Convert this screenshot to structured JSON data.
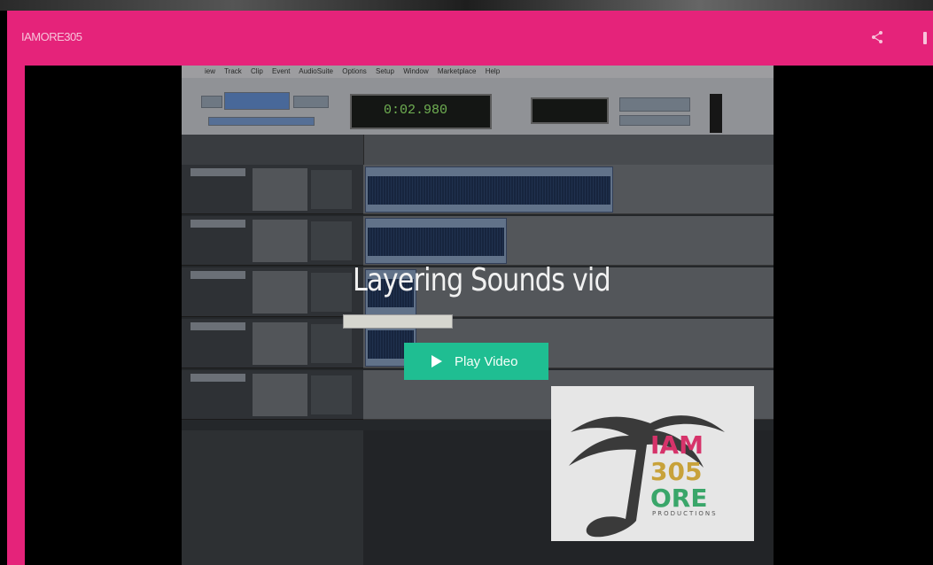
{
  "channel": {
    "name": "IAMORE305"
  },
  "video": {
    "title": "Layering Sounds vid",
    "play_label": "Play Video"
  },
  "daw": {
    "menu": [
      "iew",
      "Track",
      "Clip",
      "Event",
      "AudioSuite",
      "Options",
      "Setup",
      "Window",
      "Marketplace",
      "Help"
    ],
    "counter": "0:02.980"
  },
  "logo": {
    "lines": [
      "IAM",
      "305",
      "ORE"
    ],
    "sub": "PRODUCTIONS",
    "colors": {
      "iam": "#d6336a",
      "n305": "#c8a23a",
      "ore": "#3aa66a",
      "palm": "#3a3a3a"
    }
  },
  "colors": {
    "accent": "#e5237a",
    "play_button": "#1fbe92"
  },
  "icons": {
    "share": "share-icon",
    "more": "more-vertical-icon",
    "play": "play-icon"
  }
}
